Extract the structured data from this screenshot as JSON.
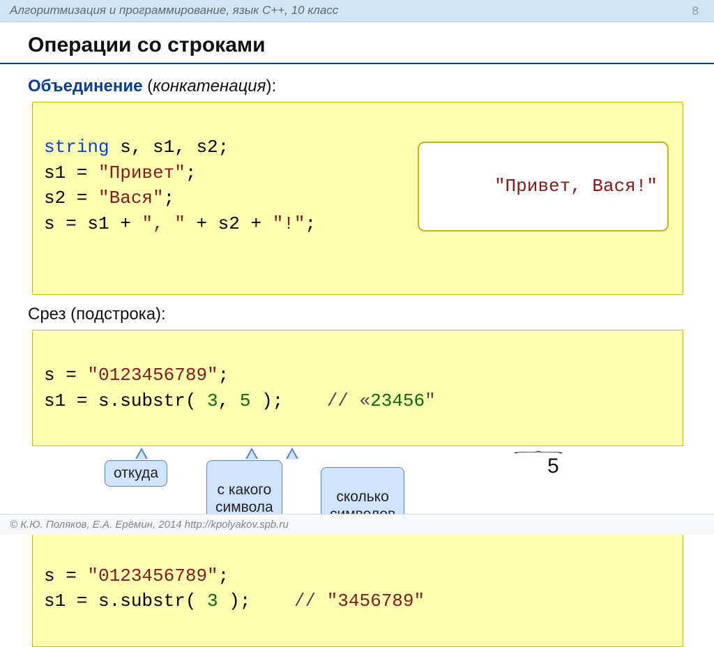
{
  "header": {
    "breadcrumb": "Алгоритмизация и программирование, язык C++, 10 класс",
    "page_number": "8"
  },
  "title": "Операции со строками",
  "section1": {
    "label_kw": "Объединение",
    "label_rest": " (",
    "label_it": "конкатенация",
    "label_close": "):",
    "code": {
      "l1a": "string",
      "l1b": " s, s1, s2;",
      "l2a": "s1 = ",
      "l2b": "\"Привет\"",
      "l2c": ";",
      "l3a": "s2 = ",
      "l3b": "\"Вася\"",
      "l3c": ";",
      "l4a": "s = s1 + ",
      "l4b": "\", \"",
      "l4c": " + s2 + ",
      "l4d": "\"!\"",
      "l4e": ";"
    },
    "result": "\"Привет, Вася!\""
  },
  "section2": {
    "label": "Срез (подстрока):",
    "code1": {
      "l1a": "s = ",
      "l1b": "\"0123456789\"",
      "l1c": ";",
      "l2a": "s1 = s.substr( ",
      "l2b": "3",
      "l2c": ", ",
      "l2d": "5",
      "l2e": " );    ",
      "l2f": "// «",
      "l2g": "23456",
      "l2h": "\""
    },
    "callouts": {
      "c1": "откуда",
      "c2": "с какого\nсимвола",
      "c3": "сколько\nсимволов",
      "len": "5"
    },
    "code2": {
      "l1a": "s = ",
      "l1b": "\"0123456789\"",
      "l1c": ";",
      "l2a": "s1 = s.substr( ",
      "l2b": "3",
      "l2c": " );    ",
      "l2d": "// ",
      "l2e": "\"3456789\""
    }
  },
  "footer": "© К.Ю. Поляков, Е.А. Ерёмин, 2014   http://kpolyakov.spb.ru"
}
